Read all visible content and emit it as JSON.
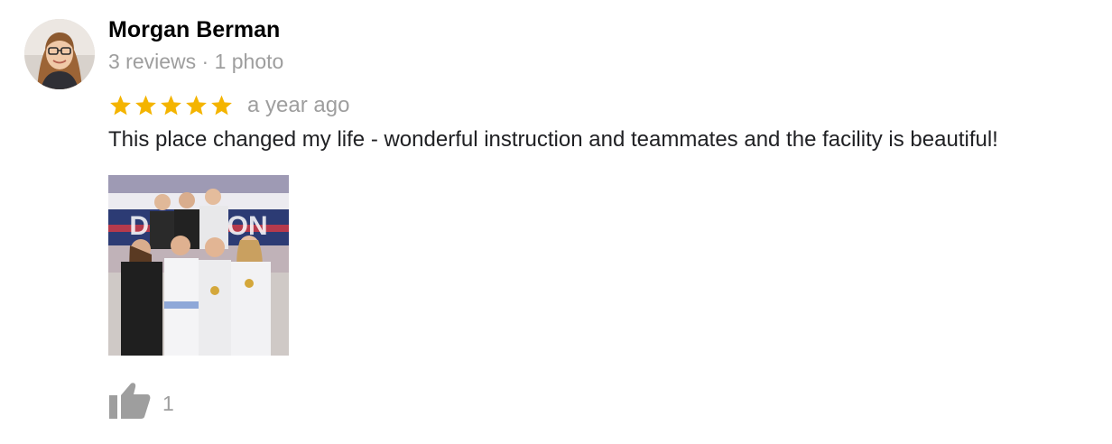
{
  "review": {
    "author": {
      "name": "Morgan Berman",
      "meta": "3 reviews · 1 photo"
    },
    "rating": {
      "value": 5,
      "max": 5,
      "star_color": "#f4b400"
    },
    "timestamp": "a year ago",
    "text": "This place changed my life - wonderful instruction and teammates and the facility is beautiful!",
    "photo_count": 1,
    "likes": {
      "icon": "thumbs-up-icon",
      "count": "1"
    }
  }
}
